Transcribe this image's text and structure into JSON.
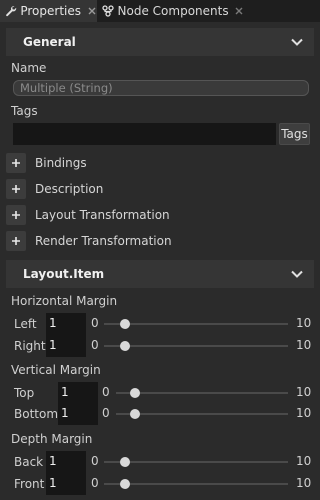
{
  "tabs": [
    {
      "label": "Properties",
      "icon": "wrench-icon",
      "active": true
    },
    {
      "label": "Node Components",
      "icon": "nodes-icon",
      "active": false
    }
  ],
  "general": {
    "title": "General",
    "name_label": "Name",
    "name_value": "Multiple (String)",
    "tags_label": "Tags",
    "tags_value": "",
    "tags_button": "Tags",
    "expanders": [
      "Bindings",
      "Description",
      "Layout Transformation",
      "Render Transformation"
    ]
  },
  "layout_item": {
    "title": "Layout.Item",
    "groups": [
      {
        "title": "Horizontal Margin",
        "rows": [
          {
            "label": "Left",
            "value": "1",
            "min": "0",
            "max": "10",
            "level": 0
          },
          {
            "label": "Right",
            "value": "1",
            "min": "0",
            "max": "10",
            "level": 0
          }
        ]
      },
      {
        "title": "Vertical Margin",
        "rows": [
          {
            "label": "Top",
            "value": "1",
            "min": "0",
            "max": "10",
            "level": 0
          },
          {
            "label": "Bottom",
            "value": "1",
            "min": "0",
            "max": "10",
            "level": 0
          }
        ]
      },
      {
        "title": "Depth Margin",
        "rows": [
          {
            "label": "Back",
            "value": "1",
            "min": "0",
            "max": "10",
            "level": 0
          },
          {
            "label": "Front",
            "value": "1",
            "min": "0",
            "max": "10",
            "level": 0
          }
        ]
      }
    ]
  }
}
